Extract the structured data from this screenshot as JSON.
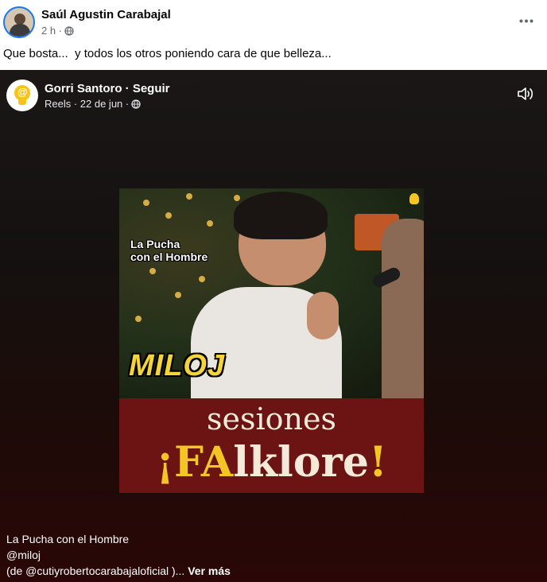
{
  "post": {
    "author": "Saúl Agustin Carabajal",
    "time": "2 h ·",
    "privacy_icon": "globe-icon",
    "more_icon": "more-dots-icon",
    "text": "Que bosta...  y todos los otros poniendo cara de que belleza..."
  },
  "shared": {
    "page_name": "Gorri Santoro · Seguir",
    "meta": "Reels · 22 de jun ·",
    "sound_icon": "speaker-icon",
    "video": {
      "overlay_title": "La Pucha\ncon el Hombre",
      "artist_tag": "MILOJ",
      "brand_line1": "sesiones",
      "brand_excl_open": "¡",
      "brand_fa": "FA",
      "brand_rest": "lklore",
      "brand_excl_close": "!"
    },
    "caption": {
      "line1": "La Pucha con el Hombre",
      "line2": "@miloj",
      "line3": "(de @cutiyrobertocarabajaloficial )... ",
      "see_more": "Ver más"
    }
  },
  "colors": {
    "brand_yellow": "#f3c623",
    "facebook_blue": "#1877f2",
    "meta_gray": "#65676b"
  }
}
